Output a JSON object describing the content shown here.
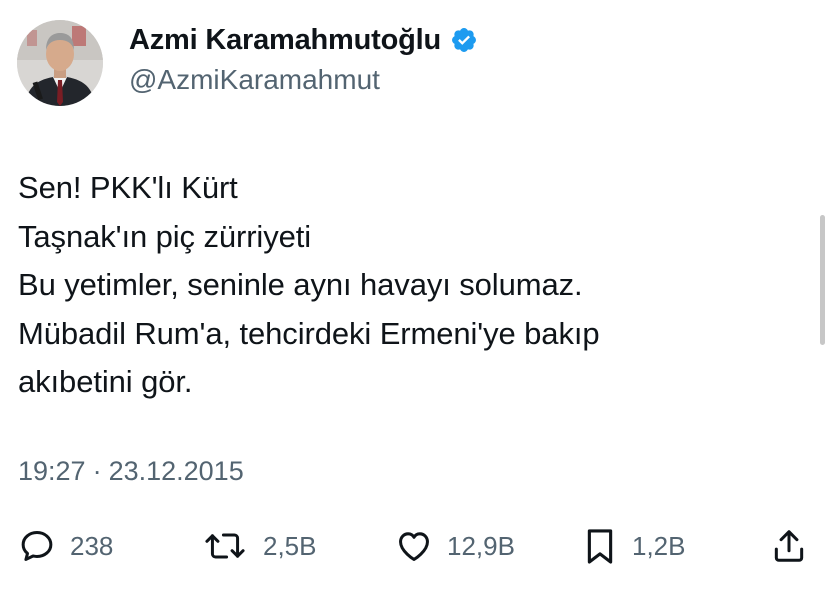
{
  "author": {
    "display_name": "Azmi Karamahmutoğlu",
    "handle": "@AzmiKaramahmut",
    "verified": true,
    "avatar_icon": "profile-photo"
  },
  "tweet": {
    "lines": [
      "Sen! PKK'lı Kürt",
      "Taşnak'ın piç zürriyeti",
      "Bu yetimler, seninle aynı havayı solumaz.",
      "Mübadil Rum'a, tehcirdeki Ermeni'ye bakıp",
      "akıbetini gör."
    ],
    "time": "19:27",
    "separator": "·",
    "date": "23.12.2015"
  },
  "actions": {
    "replies": {
      "icon": "reply-icon",
      "count": "238"
    },
    "retweets": {
      "icon": "retweet-icon",
      "count": "2,5B"
    },
    "likes": {
      "icon": "heart-icon",
      "count": "12,9B"
    },
    "bookmarks": {
      "icon": "bookmark-icon",
      "count": "1,2B"
    },
    "share": {
      "icon": "share-icon"
    }
  },
  "colors": {
    "text": "#0f1419",
    "secondary": "#536471",
    "verified": "#1d9bf0"
  }
}
